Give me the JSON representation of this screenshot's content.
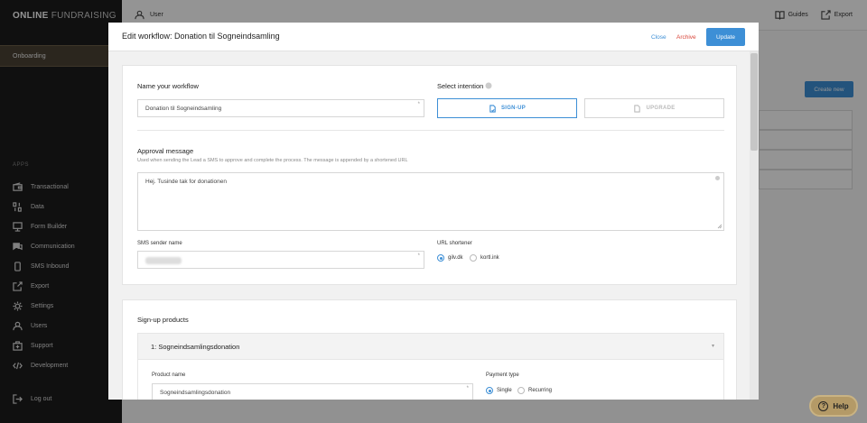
{
  "brand": {
    "part1": "ONLINE",
    "part2": "FUNDRAISING"
  },
  "sidebar": {
    "onboarding": "Onboarding",
    "apps_title": "APPS",
    "items": [
      {
        "label": "Transactional",
        "icon": "wallet-icon"
      },
      {
        "label": "Data",
        "icon": "data-icon"
      },
      {
        "label": "Form Builder",
        "icon": "monitor-icon"
      },
      {
        "label": "Communication",
        "icon": "chat-icon"
      },
      {
        "label": "SMS Inbound",
        "icon": "phone-icon"
      },
      {
        "label": "Export",
        "icon": "export-icon"
      },
      {
        "label": "Settings",
        "icon": "gear-icon"
      },
      {
        "label": "Users",
        "icon": "user-icon"
      },
      {
        "label": "Support",
        "icon": "support-icon"
      },
      {
        "label": "Development",
        "icon": "code-icon"
      }
    ],
    "logout": "Log out"
  },
  "topbar": {
    "user": "User",
    "guides": "Guides",
    "export": "Export"
  },
  "background": {
    "create_new": "Create new"
  },
  "help": {
    "label": "Help"
  },
  "modal": {
    "title": "Edit workflow: Donation til Sogneindsamling",
    "close": "Close",
    "archive": "Archive",
    "update": "Update",
    "name_label": "Name your workflow",
    "name_value": "Donation til Sogneindsamling",
    "intention_label": "Select intention",
    "intention_signup": "SIGN-UP",
    "intention_upgrade": "UPGRADE",
    "approval_label": "Approval message",
    "approval_help": "Used when sending the Lead a SMS to approve and complete the process. The message is appended by a shortened URL",
    "approval_value": "Hej. Tusinde tak for donationen",
    "sms_sender_label": "SMS sender name",
    "url_shortener_label": "URL shortener",
    "url_options": [
      "gilv.dk",
      "kortl.ink"
    ],
    "url_selected": "gilv.dk",
    "signup_products_label": "Sign-up products",
    "product_header": "1: Sogneindsamlingsdonation",
    "product_name_label": "Product name",
    "product_name_value": "Sogneindsamlingsdonation",
    "payment_type_label": "Payment type",
    "payment_options": [
      "Single",
      "Recurring"
    ],
    "payment_selected": "Single"
  },
  "colors": {
    "accent": "#3d8fd6",
    "danger": "#d9463a",
    "sidebar": "#1c1c1c",
    "help": "#b49a67"
  }
}
